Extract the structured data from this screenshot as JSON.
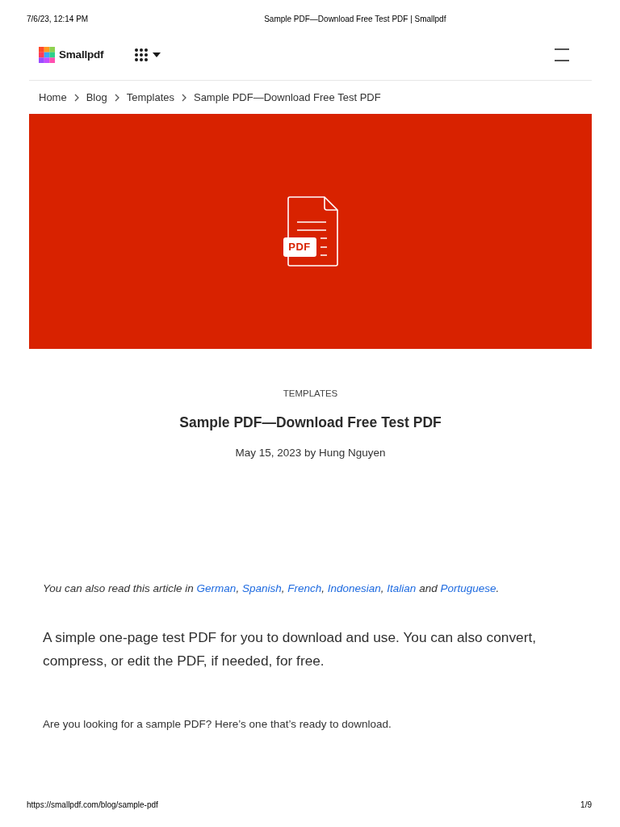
{
  "print_header": {
    "date": "7/6/23, 12:14 PM",
    "title": "Sample PDF—Download Free Test PDF | Smallpdf"
  },
  "site_header": {
    "brand": "Smallpdf"
  },
  "breadcrumb": [
    "Home",
    "Blog",
    "Templates",
    "Sample PDF—Download Free Test PDF"
  ],
  "hero": {
    "file_badge": "PDF"
  },
  "article": {
    "category": "TEMPLATES",
    "title": "Sample PDF—Download Free Test PDF",
    "byline": "May 15, 2023 by Hung Nguyen",
    "translation_note": [
      {
        "kind": "text",
        "text": "You can also read this article in "
      },
      {
        "kind": "link",
        "text": "German"
      },
      {
        "kind": "text",
        "text": ", "
      },
      {
        "kind": "link",
        "text": "Spanish"
      },
      {
        "kind": "text",
        "text": ", "
      },
      {
        "kind": "link",
        "text": "French"
      },
      {
        "kind": "text",
        "text": ", "
      },
      {
        "kind": "link",
        "text": "Indonesian"
      },
      {
        "kind": "text",
        "text": ", "
      },
      {
        "kind": "link",
        "text": "Italian"
      },
      {
        "kind": "text",
        "text": " and "
      },
      {
        "kind": "link",
        "text": "Portuguese"
      },
      {
        "kind": "text",
        "text": "."
      }
    ],
    "lead": "A simple one-page test PDF for you to download and use. You can also convert, compress, or edit the PDF, if needed, for free.",
    "paragraphs": [
      "Are you looking for a sample PDF? Here’s one that’s ready to download."
    ]
  },
  "print_footer": {
    "url": "https://smallpdf.com/blog/sample-pdf",
    "page": "1/9"
  }
}
